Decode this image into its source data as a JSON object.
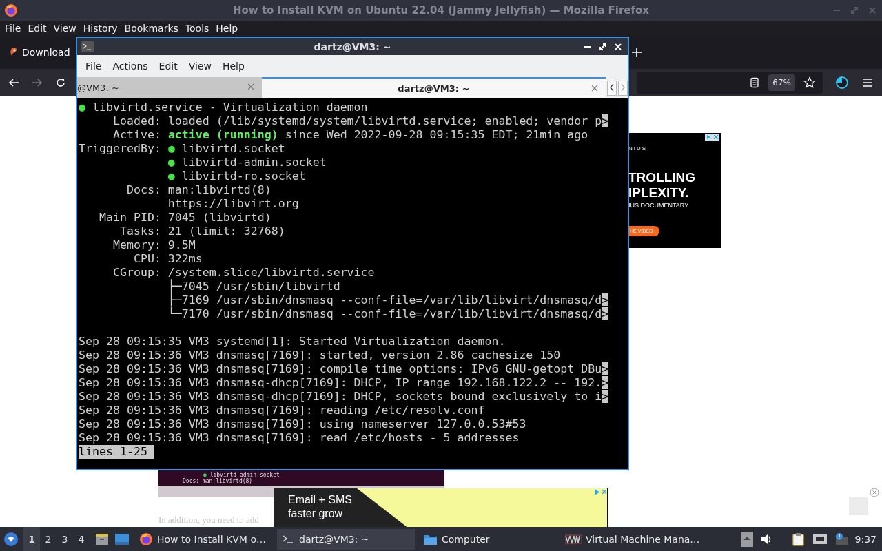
{
  "firefox": {
    "title": "How to Install KVM on Ubuntu 22.04 (Jammy Jellyfish) — Mozilla Firefox",
    "menu": [
      "File",
      "Edit",
      "View",
      "History",
      "Bookmarks",
      "Tools",
      "Help"
    ],
    "tab": {
      "label": "Download"
    },
    "zoom": "67%",
    "page": {
      "side_ad": {
        "lines": [
          "NIUS",
          "TROLLING",
          "IPLEXITY.",
          "IUS DOCUMENTARY"
        ],
        "button": "HE VIDEO"
      },
      "screenshot_lines": [
        {
          "bullet": "●",
          "text": "libvirtd-admin.socket"
        },
        {
          "text": "Docs: man:libvirtd(8)"
        }
      ],
      "paragraph": "In addition, you need to add",
      "bottom_ad": {
        "lines": [
          "Email + SMS",
          "faster grow"
        ]
      }
    }
  },
  "terminal": {
    "title": "dartz@VM3: ~",
    "menu": [
      "File",
      "Actions",
      "Edit",
      "View",
      "Help"
    ],
    "tabs": [
      {
        "label": "@VM3: ~",
        "selected": false
      },
      {
        "label": "dartz@VM3: ~",
        "selected": true
      }
    ],
    "lines": [
      {
        "kind": "output",
        "segments": [
          {
            "kind": "dot",
            "text": "●"
          },
          {
            "kind": "text",
            "text": " libvirtd.service - Virtualization daemon"
          }
        ]
      },
      {
        "kind": "output",
        "segments": [
          {
            "kind": "text",
            "text": "     Loaded: loaded (/lib/systemd/system/libvirtd.service; enabled; vendor p"
          },
          {
            "kind": "more",
            "text": ">"
          }
        ]
      },
      {
        "kind": "output",
        "segments": [
          {
            "kind": "text",
            "text": "     Active: "
          },
          {
            "kind": "bold",
            "text": "active (running)"
          },
          {
            "kind": "text",
            "text": " since Wed 2022-09-28 09:15:35 EDT; 21min ago"
          }
        ]
      },
      {
        "kind": "output",
        "segments": [
          {
            "kind": "text",
            "text": "TriggeredBy: "
          },
          {
            "kind": "dot",
            "text": "●"
          },
          {
            "kind": "text",
            "text": " libvirtd.socket"
          }
        ]
      },
      {
        "kind": "output",
        "segments": [
          {
            "kind": "dot",
            "text": "             ●"
          },
          {
            "kind": "text",
            "text": " libvirtd-admin.socket"
          }
        ]
      },
      {
        "kind": "output",
        "segments": [
          {
            "kind": "dot",
            "text": "             ●"
          },
          {
            "kind": "text",
            "text": " libvirtd-ro.socket"
          }
        ]
      },
      {
        "kind": "output",
        "segments": [
          {
            "kind": "text",
            "text": "       Docs: man:libvirtd(8)"
          }
        ]
      },
      {
        "kind": "output",
        "segments": [
          {
            "kind": "text",
            "text": "             https://libvirt.org"
          }
        ]
      },
      {
        "kind": "output",
        "segments": [
          {
            "kind": "text",
            "text": "   Main PID: 7045 (libvirtd)"
          }
        ]
      },
      {
        "kind": "output",
        "segments": [
          {
            "kind": "text",
            "text": "      Tasks: 21 (limit: 32768)"
          }
        ]
      },
      {
        "kind": "output",
        "segments": [
          {
            "kind": "text",
            "text": "     Memory: 9.5M"
          }
        ]
      },
      {
        "kind": "output",
        "segments": [
          {
            "kind": "text",
            "text": "        CPU: 322ms"
          }
        ]
      },
      {
        "kind": "output",
        "segments": [
          {
            "kind": "text",
            "text": "     CGroup: /system.slice/libvirtd.service"
          }
        ]
      },
      {
        "kind": "output",
        "segments": [
          {
            "kind": "text",
            "text": "             ├─7045 /usr/sbin/libvirtd"
          }
        ]
      },
      {
        "kind": "output",
        "segments": [
          {
            "kind": "text",
            "text": "             ├─7169 /usr/sbin/dnsmasq --conf-file=/var/lib/libvirt/dnsmasq/d"
          },
          {
            "kind": "more",
            "text": ">"
          }
        ]
      },
      {
        "kind": "output",
        "segments": [
          {
            "kind": "text",
            "text": "             └─7170 /usr/sbin/dnsmasq --conf-file=/var/lib/libvirt/dnsmasq/d"
          },
          {
            "kind": "more",
            "text": ">"
          }
        ]
      },
      {
        "kind": "blank"
      },
      {
        "kind": "output",
        "segments": [
          {
            "kind": "text",
            "text": "Sep 28 09:15:35 VM3 systemd[1]: Started Virtualization daemon."
          }
        ]
      },
      {
        "kind": "output",
        "segments": [
          {
            "kind": "text",
            "text": "Sep 28 09:15:36 VM3 dnsmasq[7169]: started, version 2.86 cachesize 150"
          }
        ]
      },
      {
        "kind": "output",
        "segments": [
          {
            "kind": "text",
            "text": "Sep 28 09:15:36 VM3 dnsmasq[7169]: compile time options: IPv6 GNU-getopt DBu"
          },
          {
            "kind": "more",
            "text": ">"
          }
        ]
      },
      {
        "kind": "output",
        "segments": [
          {
            "kind": "text",
            "text": "Sep 28 09:15:36 VM3 dnsmasq-dhcp[7169]: DHCP, IP range 192.168.122.2 -- 192."
          },
          {
            "kind": "more",
            "text": ">"
          }
        ]
      },
      {
        "kind": "output",
        "segments": [
          {
            "kind": "text",
            "text": "Sep 28 09:15:36 VM3 dnsmasq-dhcp[7169]: DHCP, sockets bound exclusively to i"
          },
          {
            "kind": "more",
            "text": ">"
          }
        ]
      },
      {
        "kind": "output",
        "segments": [
          {
            "kind": "text",
            "text": "Sep 28 09:15:36 VM3 dnsmasq[7169]: reading /etc/resolv.conf"
          }
        ]
      },
      {
        "kind": "output",
        "segments": [
          {
            "kind": "text",
            "text": "Sep 28 09:15:36 VM3 dnsmasq[7169]: using nameserver 127.0.0.53#53"
          }
        ]
      },
      {
        "kind": "output",
        "segments": [
          {
            "kind": "text",
            "text": "Sep 28 09:15:36 VM3 dnsmasq[7169]: read /etc/hosts - 5 addresses"
          }
        ]
      },
      {
        "kind": "prompt",
        "segments": [
          {
            "kind": "text",
            "text": "lines 1-25 "
          }
        ]
      }
    ]
  },
  "taskbar": {
    "workspaces": [
      {
        "label": "1",
        "selected": true
      },
      {
        "label": "2",
        "selected": false
      },
      {
        "label": "3",
        "selected": false
      },
      {
        "label": "4",
        "selected": false
      }
    ],
    "tasks": [
      {
        "kind": "firefox",
        "label": "How to Install KVM o…",
        "selected": false
      },
      {
        "kind": "terminal",
        "label": "dartz@VM3: ~",
        "selected": true
      },
      {
        "kind": "folder",
        "label": "Computer",
        "selected": false
      },
      {
        "kind": "vmm",
        "label": "Virtual Machine Mana…",
        "selected": false
      }
    ],
    "clock": "9:37"
  }
}
